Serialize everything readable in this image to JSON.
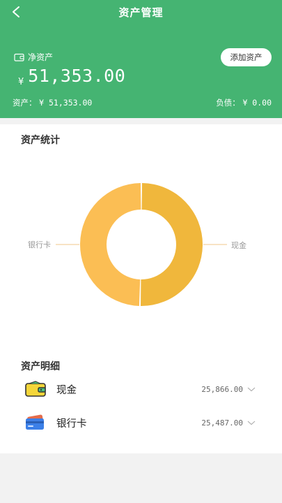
{
  "header": {
    "title": "资产管理",
    "net_assets_label": "净资产",
    "currency_symbol": "¥",
    "net_assets_value": "51,353.00",
    "add_button_label": "添加资产",
    "assets_label": "资产：",
    "assets_value": "¥ 51,353.00",
    "liabilities_label": "负债：",
    "liabilities_value": "¥ 0.00",
    "bg_color": "#45b472"
  },
  "stats": {
    "title": "资产统计",
    "left_label": "银行卡",
    "right_label": "现金",
    "colors": {
      "cash": "#f0b73c",
      "bank": "#fbbe54"
    }
  },
  "chart_data": {
    "type": "pie",
    "categories": [
      "现金",
      "银行卡"
    ],
    "values": [
      25866.0,
      25487.0
    ]
  },
  "details": {
    "title": "资产明细",
    "items": [
      {
        "name": "现金",
        "amount": "25,866.00",
        "icon": "wallet-icon"
      },
      {
        "name": "银行卡",
        "amount": "25,487.00",
        "icon": "bank-card-icon"
      }
    ]
  }
}
